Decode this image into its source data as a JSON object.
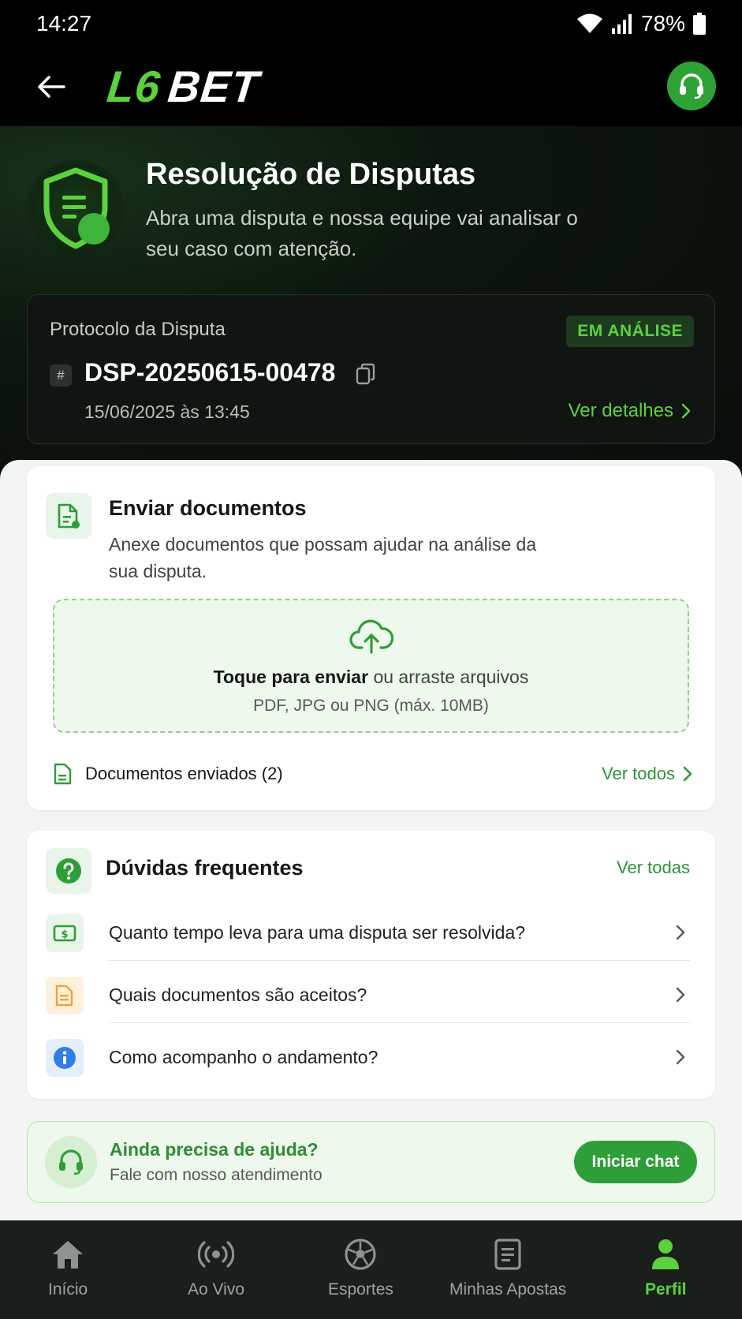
{
  "status_bar": {
    "time": "14:27",
    "battery": "78%"
  },
  "header": {
    "logo_part1": "L6",
    "logo_part2": "BET"
  },
  "hero": {
    "title": "Resolução de Disputas",
    "subtitle": "Abra uma disputa e nossa equipe vai analisar o seu caso com atenção."
  },
  "protocol": {
    "label": "Protocolo da Disputa",
    "status": "EM ANÁLISE",
    "hash": "#",
    "id": "DSP-20250615-00478",
    "date": "15/06/2025 às 13:45",
    "details_link": "Ver detalhes"
  },
  "upload": {
    "title": "Enviar documentos",
    "description": "Anexe documentos que possam ajudar na análise da sua disputa.",
    "drop_bold": "Toque para enviar",
    "drop_rest": " ou arraste arquivos",
    "drop_hint": "PDF, JPG ou PNG (máx. 10MB)",
    "sent_label": "Documentos enviados (2)",
    "see_all": "Ver todos"
  },
  "faq": {
    "title": "Dúvidas frequentes",
    "see_all": "Ver todas",
    "items": [
      {
        "text": "Quanto tempo leva para uma disputa ser resolvida?",
        "icon": "money-icon"
      },
      {
        "text": "Quais documentos são aceitos?",
        "icon": "document-icon"
      },
      {
        "text": "Como acompanho o andamento?",
        "icon": "info-icon"
      }
    ]
  },
  "help": {
    "title": "Ainda precisa de ajuda?",
    "subtitle": "Fale com nosso atendimento",
    "button": "Iniciar chat"
  },
  "bottom_nav": {
    "items": [
      {
        "label": "Início",
        "icon": "home-icon"
      },
      {
        "label": "Ao Vivo",
        "icon": "live-icon"
      },
      {
        "label": "Esportes",
        "icon": "soccer-ball-icon"
      },
      {
        "label": "Minhas Apostas",
        "icon": "bets-icon"
      },
      {
        "label": "Perfil",
        "icon": "profile-icon",
        "active": true
      }
    ]
  },
  "colors": {
    "brand_green": "#5cd13d",
    "accent_green": "#2e9e38",
    "dark_bg": "#0b0f0b"
  }
}
